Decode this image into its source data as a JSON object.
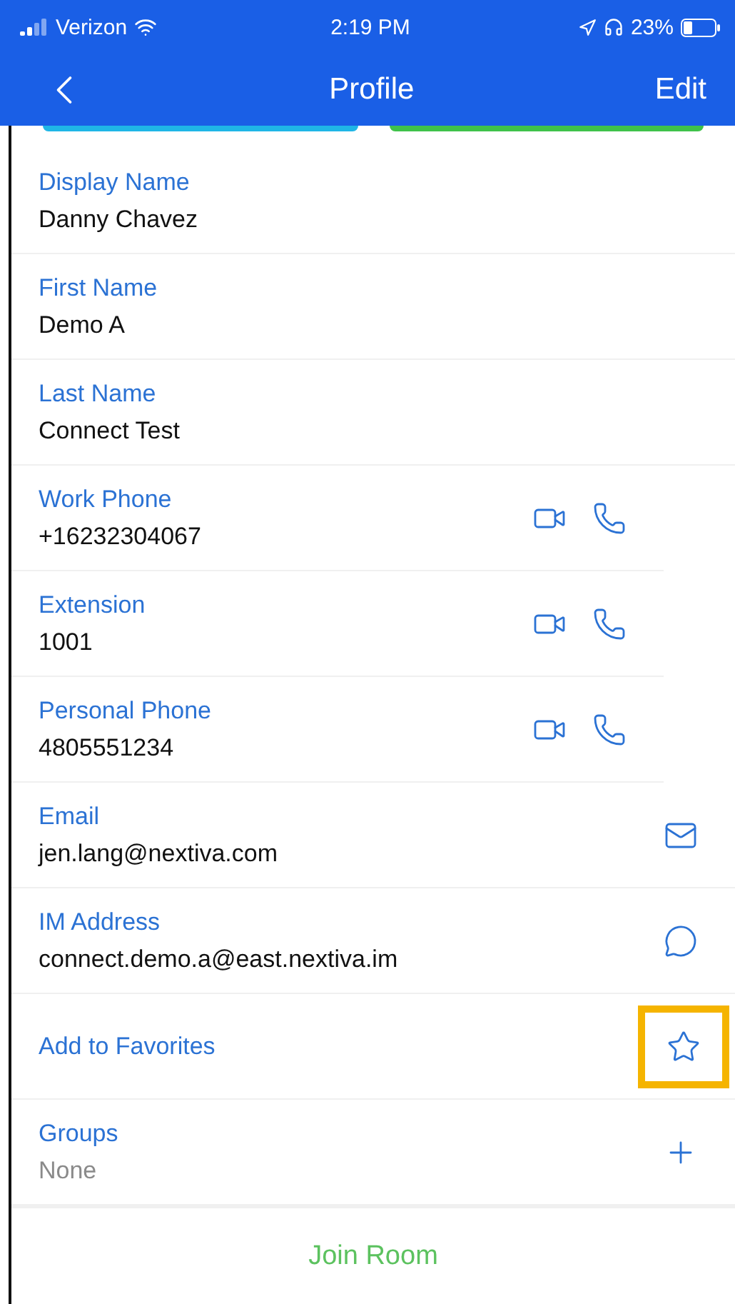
{
  "status_bar": {
    "carrier": "Verizon",
    "time": "2:19 PM",
    "battery": "23%"
  },
  "nav": {
    "title": "Profile",
    "action": "Edit"
  },
  "fields": [
    {
      "label": "Display Name",
      "value": "Danny Chavez",
      "muted": false
    },
    {
      "label": "First Name",
      "value": "Demo A",
      "muted": false
    },
    {
      "label": "Last Name",
      "value": "Connect Test",
      "muted": false
    },
    {
      "label": "Work Phone",
      "value": "+16232304067",
      "muted": false,
      "actions": [
        {
          "kind": "video"
        },
        {
          "kind": "phone"
        }
      ]
    },
    {
      "label": "Extension",
      "value": "1001",
      "muted": false,
      "actions": [
        {
          "kind": "video"
        },
        {
          "kind": "phone"
        }
      ]
    },
    {
      "label": "Personal Phone",
      "value": "4805551234",
      "muted": false,
      "actions": [
        {
          "kind": "video"
        },
        {
          "kind": "phone"
        }
      ]
    },
    {
      "label": "Email",
      "value": "jen.lang@nextiva.com",
      "muted": false,
      "actions": [
        {
          "kind": "mail"
        }
      ]
    },
    {
      "label": "IM Address",
      "value": "connect.demo.a@east.nextiva.im",
      "muted": false,
      "actions": [
        {
          "kind": "chat"
        }
      ]
    },
    {
      "label": "Add to Favorites",
      "actions": [
        {
          "kind": "star",
          "highlighted": true
        }
      ]
    },
    {
      "label": "Groups",
      "value": "None",
      "muted": true,
      "actions": [
        {
          "kind": "plus"
        }
      ]
    }
  ],
  "footer": {
    "label": "Join Room"
  }
}
